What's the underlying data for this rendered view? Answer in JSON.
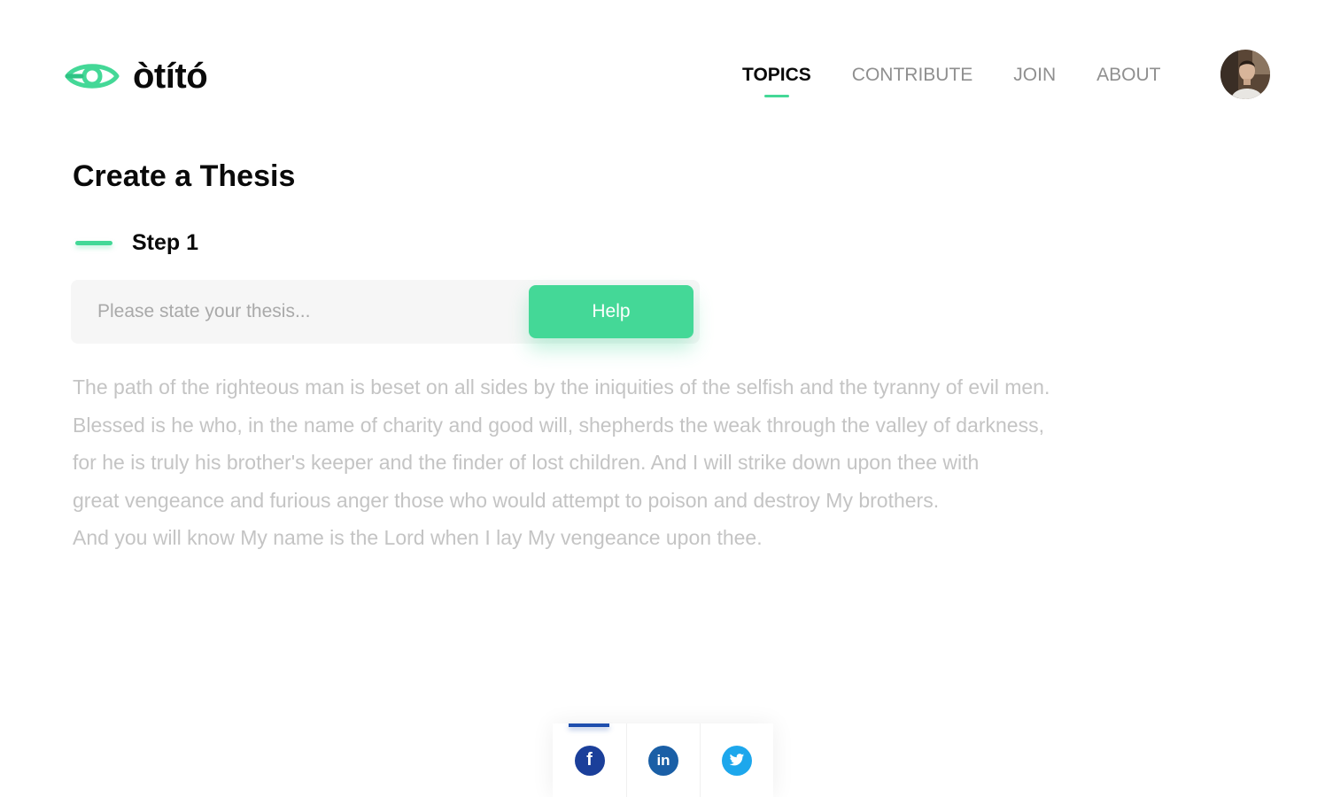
{
  "brand": {
    "name": "òtító",
    "accent_color": "#44d897"
  },
  "nav": {
    "items": [
      {
        "label": "TOPICS",
        "active": true
      },
      {
        "label": "CONTRIBUTE",
        "active": false
      },
      {
        "label": "JOIN",
        "active": false
      },
      {
        "label": "ABOUT",
        "active": false
      }
    ]
  },
  "user": {
    "avatar_icon": "user-avatar-photo"
  },
  "page": {
    "title": "Create a Thesis",
    "step_label": "Step 1"
  },
  "thesis": {
    "placeholder": "Please state your thesis...",
    "value": "",
    "help_label": "Help"
  },
  "body_lines": [
    "The path of the righteous man is beset on all sides by the iniquities of the selfish and the tyranny of evil men.",
    "Blessed is he who, in the name of charity and good will, shepherds the weak through the valley of darkness,",
    "for he is truly his brother's keeper and the finder of lost children. And I will strike down upon thee with",
    "great vengeance and furious anger those who would attempt to poison and destroy My brothers.",
    "And you will know My name is the Lord when I lay My vengeance upon thee."
  ],
  "share": {
    "items": [
      {
        "name": "facebook",
        "icon": "facebook-icon",
        "glyph": "f",
        "color": "#1b3f9a",
        "active": true
      },
      {
        "name": "linkedin",
        "icon": "linkedin-icon",
        "glyph": "in",
        "color": "#1a5fa6",
        "active": false
      },
      {
        "name": "twitter",
        "icon": "twitter-icon",
        "glyph": "t",
        "color": "#1da7ec",
        "active": false
      }
    ]
  }
}
